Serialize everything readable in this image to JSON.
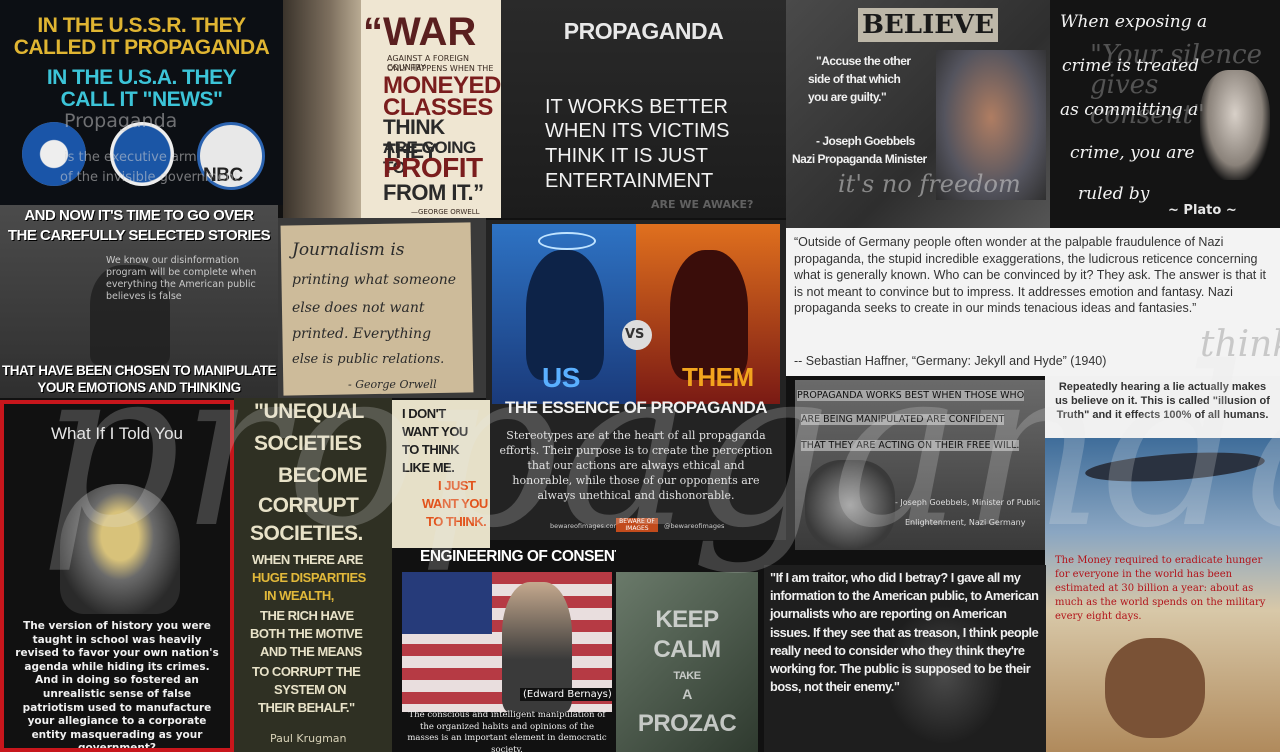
{
  "ussr": {
    "line1": "IN THE U.S.S.R. THEY",
    "line2": "CALLED IT PROPAGANDA",
    "line3": "IN THE U.S.A. THEY",
    "line4": "CALL IT \"NEWS\"",
    "faint1": "Propaganda",
    "faint2": "is the executive arm",
    "faint3": "of the invisible government",
    "logo_nbc": "NBC",
    "logo_ge": "ge",
    "logo_cbs": "CBS"
  },
  "war": {
    "l1": "“WAR",
    "l2": "AGAINST A FOREIGN COUNTRY",
    "l3": "ONLY HAPPENS WHEN THE",
    "l4": "MONEYED",
    "l5": "CLASSES",
    "l6": "THINK THEY",
    "l7": "ARE GOING TO",
    "l8": "PROFIT",
    "l9": "FROM IT.”",
    "author": "—GEORGE ORWELL"
  },
  "propaganda": {
    "title": "PROPAGANDA",
    "l1": "IT WORKS BETTER",
    "l2": "WHEN ITS VICTIMS",
    "l3": "THINK IT IS JUST",
    "l4": "ENTERTAINMENT",
    "faint": "ARE WE AWAKE?"
  },
  "goebbels": {
    "sign": "BELIEVE",
    "q1": "\"Accuse the other",
    "q2": "side of that which",
    "q3": "you are guilty.\"",
    "author": "- Joseph Goebbels",
    "role": "Nazi Propaganda Minister",
    "faint": "it's no freedom"
  },
  "exposing": {
    "l1": "When exposing a",
    "l2": "crime is treated",
    "l3": "as committing a",
    "l4": "crime, you are",
    "l5": "ruled by",
    "author": "~ Plato ~",
    "faint": "\"Your silence gives consent\""
  },
  "stories": {
    "top1": "AND NOW IT'S TIME TO GO OVER",
    "top2": "THE CAREFULLY SELECTED STORIES",
    "mid": "We know our disinformation program will be complete when everything the American public believes is false",
    "bot1": "THAT HAVE BEEN CHOSEN TO MANIPULATE",
    "bot2": "YOUR EMOTIONS AND THINKING"
  },
  "journalism": {
    "l1": "Journalism is",
    "l2": "printing what someone",
    "l3": "else does not want",
    "l4": "printed. Everything",
    "l5": "else is public relations.",
    "author": "- George Orwell"
  },
  "usthem": {
    "us": "US",
    "vs": "VS",
    "them": "THEM",
    "title": "THE ESSENCE OF PROPAGANDA",
    "body": "Stereotypes are at the heart of all propaganda efforts. Their purpose is to create the perception that our actions are always ethical and honorable, while those of our opponents are always unethical and dishonorable.",
    "site": "bewareofimages.com",
    "badge": "BEWARE OF IMAGES",
    "handle": "@bewareofimages"
  },
  "haffner": {
    "quote": "“Outside of Germany people often wonder at the palpable fraudulence of Nazi propaganda, the stupid incredible exaggerations, the ludicrous reticence concerning what is generally known. Who can be convinced by it? They ask. The answer is that it is not meant to convince but to impress. It addresses emotion and fantasy. Nazi propaganda seeks to create in our minds tenacious ideas and fantasies.”",
    "cite": "-- Sebastian Haffner, “Germany: Jekyll and Hyde” (1940)",
    "faint": "think!"
  },
  "whatif": {
    "title": "What If I Told You",
    "body": "The version of history you were taught in school was heavily revised to favor your own nation's agenda while hiding its crimes. And in doing so fostered an unrealistic sense of false patriotism used to manufacture your allegiance to a corporate entity masquerading as your government?"
  },
  "krugman": {
    "l1": "\"UNEQUAL",
    "l2": "SOCIETIES",
    "l3": "BECOME",
    "l4": "CORRUPT",
    "l5": "SOCIETIES.",
    "l6": "WHEN THERE ARE",
    "l7": "HUGE DISPARITIES",
    "l8": "IN WEALTH,",
    "l9": "THE RICH HAVE",
    "l10": "BOTH THE MOTIVE",
    "l11": "AND THE MEANS",
    "l12": "TO CORRUPT THE",
    "l13": "SYSTEM ON",
    "l14": "THEIR BEHALF.\"",
    "author": "Paul Krugman"
  },
  "thinklike": {
    "l1": "I DON'T",
    "l2": "WANT YOU",
    "l3": "TO THINK",
    "l4": "LIKE ME.",
    "l5": "I JUST",
    "l6": "WANT YOU",
    "l7": "TO THINK."
  },
  "repeat": {
    "text": "Repeatedly hearing a lie actually makes us believe on it. This is called \"illusion of Truth\" and it effects 100% of all humans."
  },
  "goebbels2": {
    "l1": "PROPAGANDA WORKS BEST WHEN THOSE WHO",
    "l2": "ARE BEING MANIPULATED ARE CONFIDENT",
    "l3": "THAT THEY ARE ACTING ON THEIR FREE WILL.",
    "author": "- Joseph Goebbels, Minister of Public",
    "role": "Enlightenment, Nazi Germany"
  },
  "hunger": {
    "text": "The Money required to eradicate hunger for everyone in the world has been estimated at 30 billion a year: about as much as the world spends on the military every eight days."
  },
  "bernays": {
    "title": "ENGINEERING OF CONSENT AND PHARMA",
    "name": "(Edward Bernays)",
    "body": "The conscious and intelligent manipulation of the organized habits and opinions of the masses is an important element in democratic society."
  },
  "keepcalm": {
    "l1": "KEEP",
    "l2": "CALM",
    "l3": "TAKE",
    "l4": "A",
    "l5": "PROZAC"
  },
  "snowden": {
    "text": "\"If I am traitor, who did I betray? I gave all my information to the American public, to American journalists who are reporting on American issues. If they see that as treason, I think people really need to consider who they think they're working for. The public is supposed to be their boss, not their enemy.\""
  },
  "overlay": {
    "word": "propaganda"
  },
  "colors": {
    "gold": "#e0b532",
    "cyan": "#3cc4d8",
    "red_border": "#c8161c",
    "orange": "#f2a51e"
  }
}
